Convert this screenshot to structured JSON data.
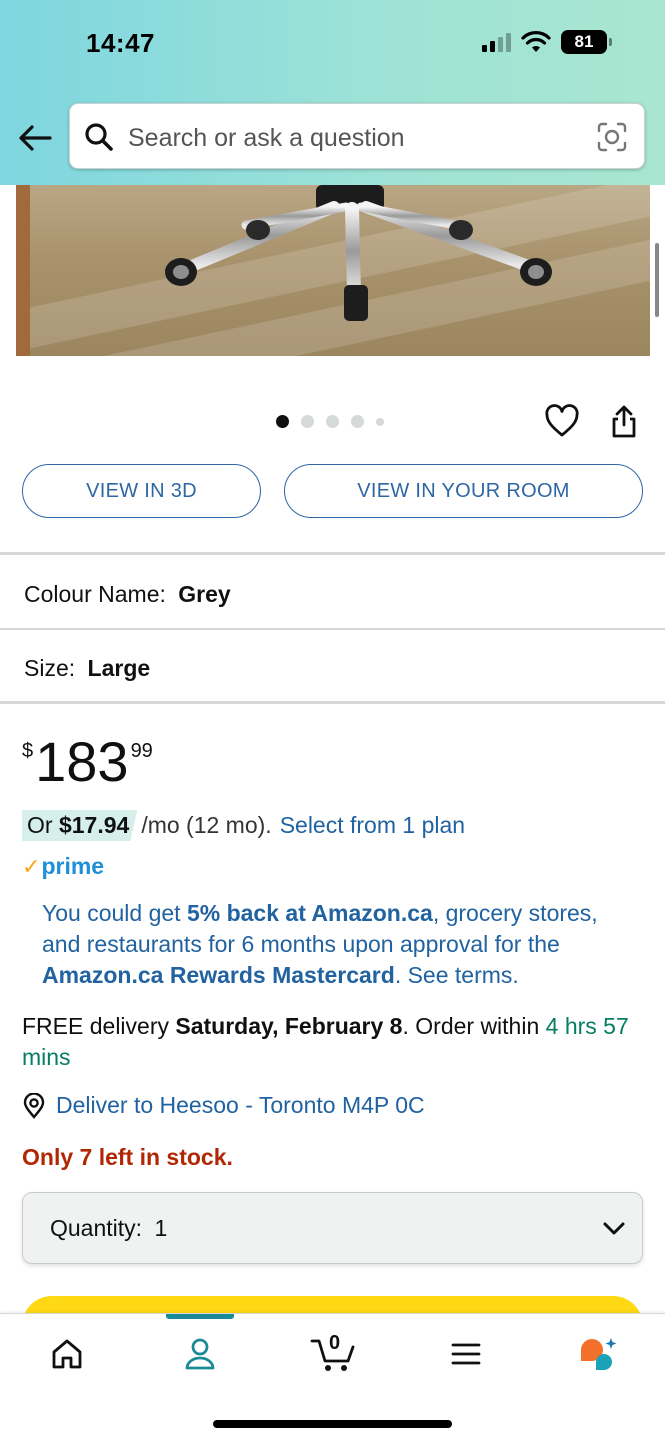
{
  "status_bar": {
    "time": "14:47",
    "battery": "81"
  },
  "search": {
    "placeholder": "Search or ask a question"
  },
  "media": {
    "image_dots_total": 5,
    "active_dot": 1
  },
  "buttons": {
    "view_3d": "VIEW IN 3D",
    "view_room": "VIEW IN YOUR ROOM"
  },
  "variations": {
    "colour_label": "Colour Name:",
    "colour_value": "Grey",
    "size_label": "Size:",
    "size_value": "Large"
  },
  "price": {
    "symbol": "$",
    "whole": "183",
    "fraction": "99"
  },
  "installment": {
    "prefix": "Or",
    "amount": "$17.94",
    "suffix": "/mo (12 mo).",
    "link": "Select from 1 plan"
  },
  "prime": {
    "label": "prime"
  },
  "promo": {
    "text_1": "You could get ",
    "bold_1": "5% back at Amazon.ca",
    "text_2": ", grocery stores, and restaurants for 6 months upon approval for the ",
    "bold_2": "Amazon.ca Rewards Mastercard",
    "text_3": ". See terms."
  },
  "delivery": {
    "prefix": "FREE delivery ",
    "date": "Saturday, February 8",
    "middle": ". Order within ",
    "countdown": "4 hrs 57 mins"
  },
  "deliver_to": {
    "text": "Deliver to Heesoo - Toronto M4P 0C"
  },
  "stock": {
    "text": "Only 7 left in stock."
  },
  "quantity": {
    "label": "Quantity:",
    "value": "1"
  },
  "cart": {
    "count": "0"
  },
  "colors": {
    "link": "#2162a1",
    "stock_red": "#b12704",
    "delivery_green": "#067d62",
    "buy_yellow": "#ffd814",
    "prime_blue": "#1f8fd6",
    "tab_active": "#198a96"
  },
  "tabbar": {
    "items": [
      "home-icon",
      "account-icon",
      "cart-icon",
      "menu-icon",
      "rufus-icon"
    ],
    "active": "account-icon"
  }
}
